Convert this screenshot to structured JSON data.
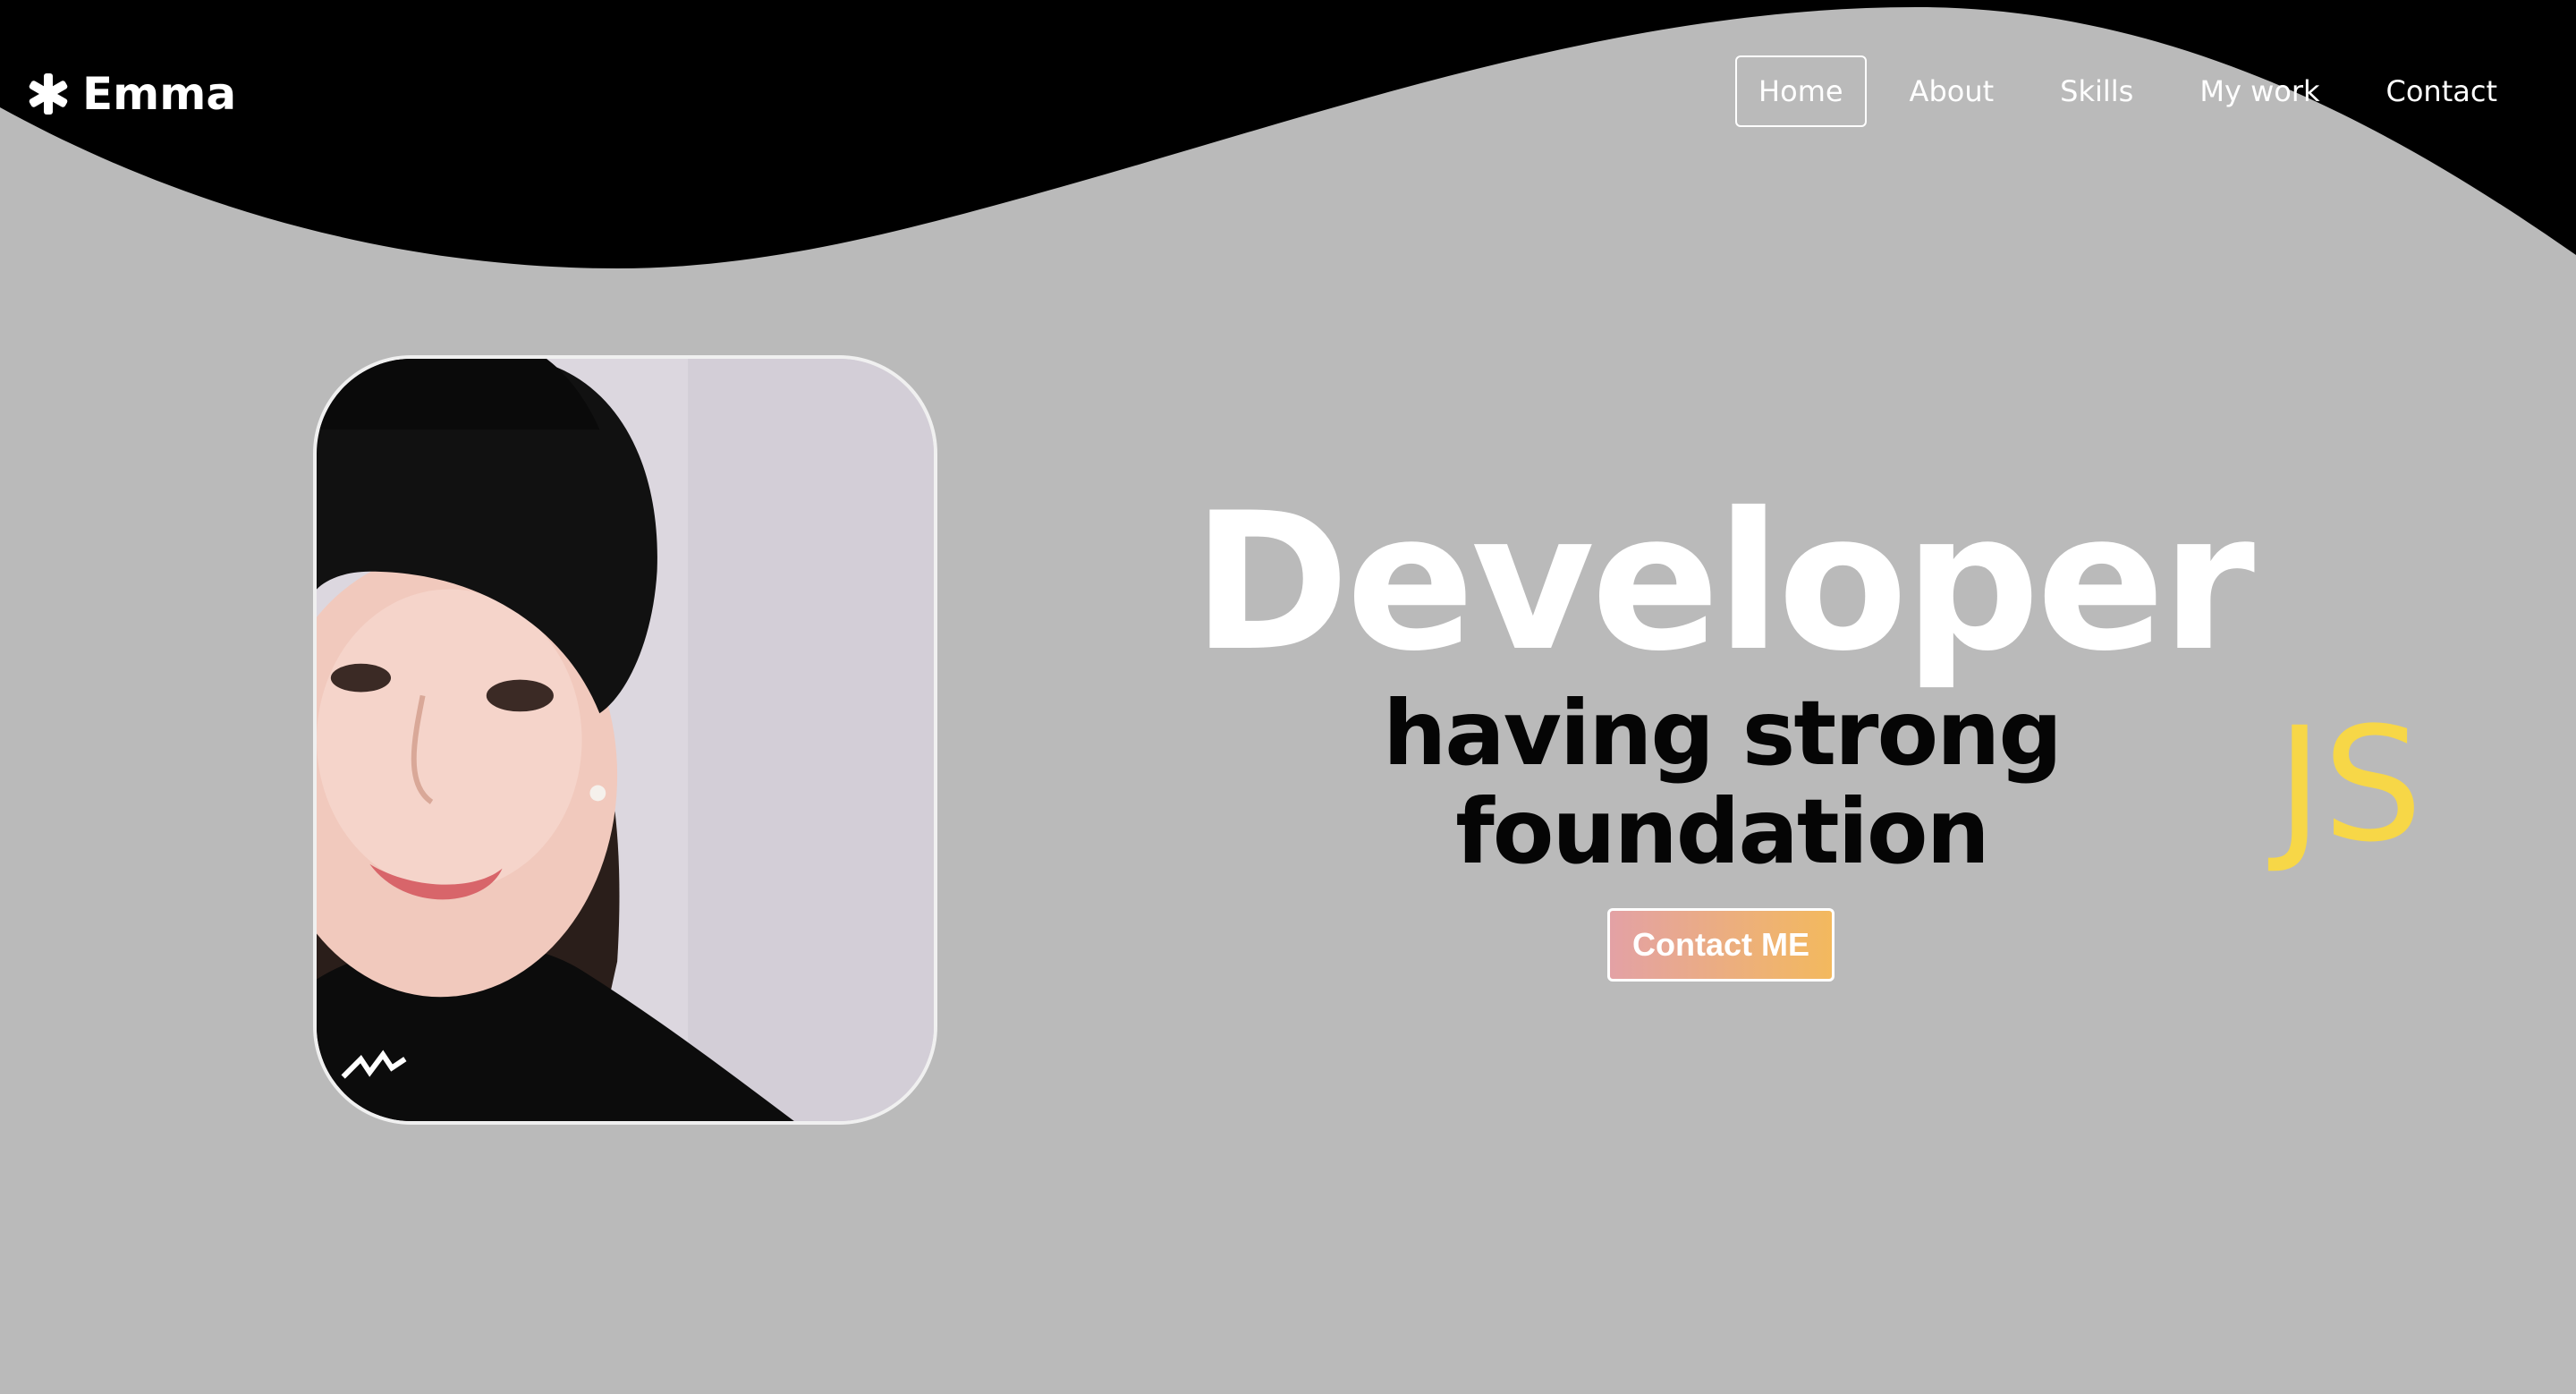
{
  "brand": {
    "name": "Emma",
    "icon": "asterisk-icon"
  },
  "nav": {
    "items": [
      {
        "label": "Home",
        "active": true
      },
      {
        "label": "About",
        "active": false
      },
      {
        "label": "Skills",
        "active": false
      },
      {
        "label": "My work",
        "active": false
      },
      {
        "label": "Contact",
        "active": false
      }
    ]
  },
  "hero": {
    "headline": "Developer",
    "subline": "having strong foundation",
    "rotating_word": "JS",
    "cta_label": "Contact ME"
  },
  "colors": {
    "background": "#bababa",
    "header": "#000000",
    "js_accent": "#f7d747",
    "cta_gradient_start": "#e3a1a5",
    "cta_gradient_end": "#f3b95e"
  }
}
